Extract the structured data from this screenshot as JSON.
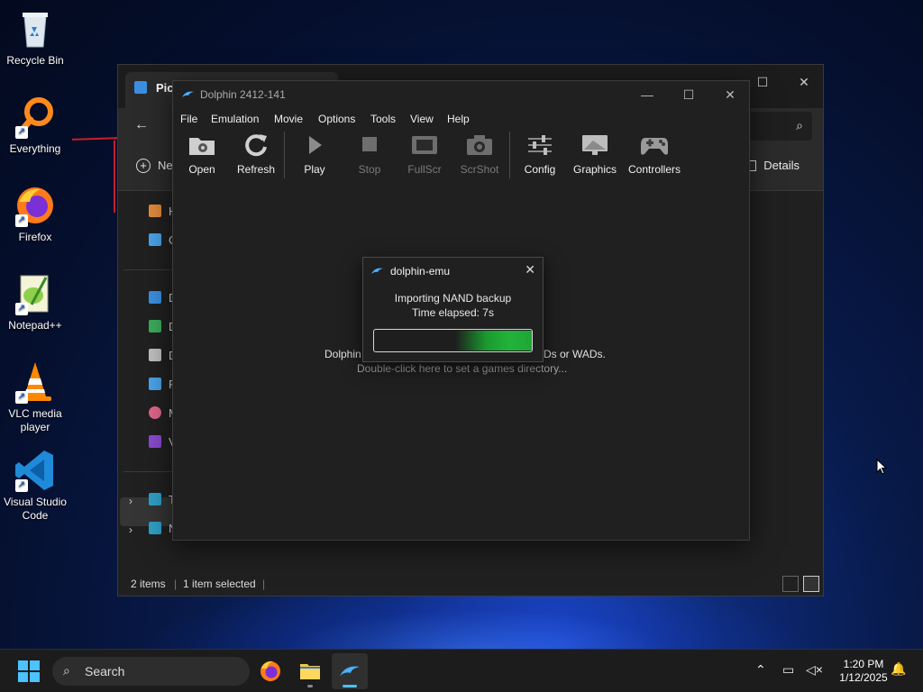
{
  "desktop": {
    "icons": [
      {
        "label": "Recycle Bin"
      },
      {
        "label": "Everything"
      },
      {
        "label": "Firefox"
      },
      {
        "label": "Notepad++"
      },
      {
        "label": "VLC media player"
      },
      {
        "label": "Visual Studio Code"
      }
    ]
  },
  "explorer": {
    "tab_title": "Pict",
    "new_label": "Ne",
    "details_label": "Details",
    "sidebar": [
      "H",
      "G",
      "D",
      "D",
      "D",
      "P",
      "M",
      "V",
      "T",
      "N"
    ],
    "status_items": "2 items",
    "status_selected": "1 item selected"
  },
  "dolphin": {
    "title": "Dolphin 2412-141",
    "menu": [
      "File",
      "Emulation",
      "Movie",
      "Options",
      "Tools",
      "View",
      "Help"
    ],
    "toolbar": [
      {
        "label": "Open",
        "enabled": true
      },
      {
        "label": "Refresh",
        "enabled": true
      },
      {
        "label": "Play",
        "enabled": true
      },
      {
        "label": "Stop",
        "enabled": false
      },
      {
        "label": "FullScr",
        "enabled": false
      },
      {
        "label": "ScrShot",
        "enabled": false
      },
      {
        "label": "Config",
        "enabled": true
      },
      {
        "label": "Graphics",
        "enabled": true
      },
      {
        "label": "Controllers",
        "enabled": true
      }
    ],
    "empty_line1_start": "Dolphin",
    "empty_line1_end": "Ds or WADs.",
    "empty_line2": "Double-click here to set a games directory..."
  },
  "dialog": {
    "title": "dolphin-emu",
    "message": "Importing NAND backup",
    "elapsed": "Time elapsed: 7s",
    "progress": "busy-indicator"
  },
  "taskbar": {
    "search_label": "Search",
    "time": "1:20 PM",
    "date": "1/12/2025"
  },
  "colors": {
    "accent": "#4cc2ff",
    "progress_green": "#23b33a"
  }
}
